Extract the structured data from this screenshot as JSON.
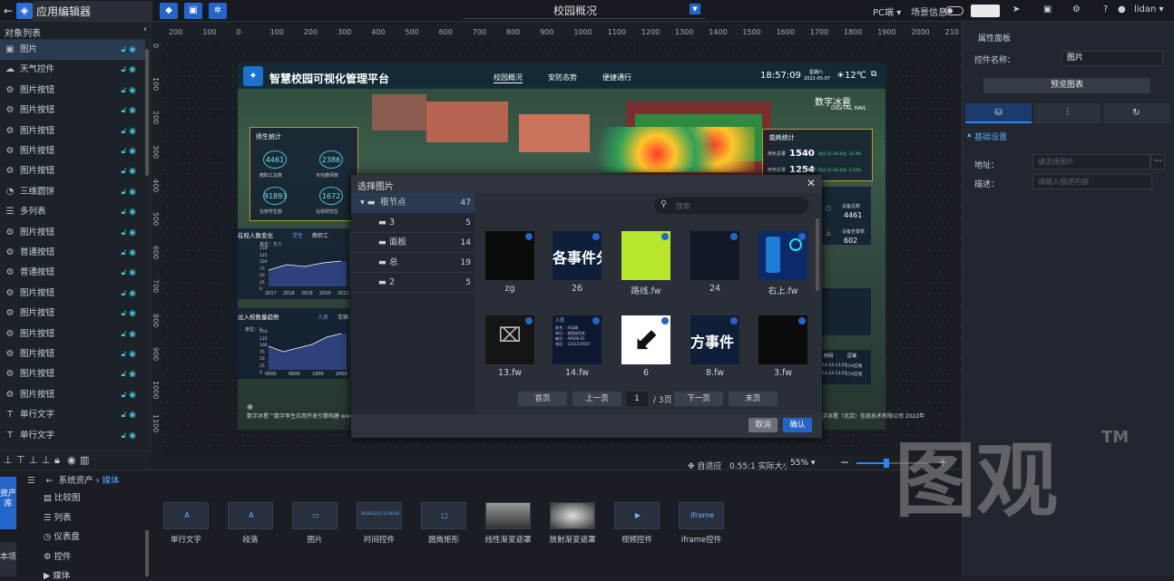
{
  "app": {
    "back_icon": "arrow-left-icon",
    "title": "应用编辑器",
    "page_name": "校园概况",
    "device": "PC端",
    "scene_info": "场景信息",
    "user": "lidan"
  },
  "left_panel": {
    "title": "对象列表",
    "layers": [
      {
        "label": "图片",
        "icon": "image-icon",
        "selected": true
      },
      {
        "label": "天气控件",
        "icon": "weather-icon"
      },
      {
        "label": "图片按钮",
        "icon": "gear-icon"
      },
      {
        "label": "图片按钮",
        "icon": "gear-icon"
      },
      {
        "label": "图片按钮",
        "icon": "gear-icon"
      },
      {
        "label": "图片按钮",
        "icon": "gear-icon"
      },
      {
        "label": "图片按钮",
        "icon": "gear-icon"
      },
      {
        "label": "三维圆饼",
        "icon": "pie-icon"
      },
      {
        "label": "多列表",
        "icon": "list-icon"
      },
      {
        "label": "图片按钮",
        "icon": "gear-icon"
      },
      {
        "label": "普通按钮",
        "icon": "gear-icon"
      },
      {
        "label": "普通按钮",
        "icon": "gear-icon"
      },
      {
        "label": "图片按钮",
        "icon": "gear-icon"
      },
      {
        "label": "图片按钮",
        "icon": "gear-icon"
      },
      {
        "label": "图片按钮",
        "icon": "gear-icon"
      },
      {
        "label": "图片按钮",
        "icon": "gear-icon"
      },
      {
        "label": "图片按钮",
        "icon": "gear-icon"
      },
      {
        "label": "图片按钮",
        "icon": "gear-icon"
      },
      {
        "label": "单行文字",
        "icon": "text-icon"
      },
      {
        "label": "单行文字",
        "icon": "text-icon"
      }
    ]
  },
  "rulers": {
    "h": [
      "200",
      "100",
      "0",
      "100",
      "200",
      "300",
      "400",
      "500",
      "600",
      "700",
      "800",
      "900",
      "1000",
      "1100",
      "1200",
      "1300",
      "1400",
      "1500",
      "1600",
      "1700",
      "1800",
      "1900",
      "2000",
      "210"
    ],
    "v": [
      "0",
      "100",
      "200",
      "300",
      "400",
      "500",
      "600",
      "700",
      "800",
      "900",
      "1000",
      "1100"
    ]
  },
  "dashboard": {
    "title": "智慧校园可视化管理平台",
    "tabs": [
      "校园概况",
      "安防态势",
      "便捷通行"
    ],
    "time": "18:57:09",
    "weekday": "星期六",
    "date": "2022-05-07",
    "temp": "12℃",
    "brand": "数字冰雹",
    "brand_en": "DIGITAL HAIL",
    "left_panel_title": "师生统计",
    "stats": [
      {
        "value": "4461",
        "label": "教职工总数"
      },
      {
        "value": "2386",
        "label": "专任教师数"
      },
      {
        "value": "91893",
        "label": "在校学生数"
      },
      {
        "value": "1672",
        "label": "在校研究生"
      }
    ],
    "enroll_title": "在校人数变化",
    "enroll_tabs": [
      "学生",
      "教职工"
    ],
    "enroll_unit": "单位：万人",
    "enroll_years": [
      "2017",
      "2018",
      "2019",
      "2020",
      "2021"
    ],
    "enroll_y": [
      "150",
      "125",
      "100",
      "75",
      "50",
      "25",
      "0"
    ],
    "flow_title": "出入校数量趋势",
    "flow_tabs": [
      "人员",
      "车辆"
    ],
    "flow_unit": "单位：人",
    "flow_x": [
      "0000",
      "0600",
      "1800",
      "2400"
    ],
    "flow_y": [
      "150",
      "125",
      "100",
      "75",
      "50",
      "25",
      "0"
    ],
    "right_title": "能耗统计",
    "right_rows": [
      {
        "label": "用水总量",
        "value": "1540",
        "unit": "t",
        "extra": "同比 12.3%  环比 -11.3%"
      },
      {
        "label": "用电总量",
        "value": "1254",
        "unit": "kWh",
        "extra": "同比 12.3%  环比 -1.12%"
      }
    ],
    "device_total": "4461",
    "device_total_label": "设备总数",
    "device_alarm": "602",
    "device_alarm_label": "设备告警数",
    "table_header": [
      "时间",
      "区域"
    ],
    "table_rows": [
      [
        "12-14 13:25",
        "C1A区域"
      ],
      [
        "12-14 13:25",
        "C1A区域"
      ]
    ],
    "footer_left": "数字冰雹™数字孪生应用开发引擎构建 www.digihail.com",
    "footer_right": "数字冰雹（北京）信息技术有限公司 2022年"
  },
  "modal": {
    "title": "选择图片",
    "search_placeholder": "搜索",
    "tree": [
      {
        "label": "根节点",
        "count": "47",
        "root": true
      },
      {
        "label": "3",
        "count": "5"
      },
      {
        "label": "面板",
        "count": "14"
      },
      {
        "label": "总",
        "count": "19"
      },
      {
        "label": "2",
        "count": "5"
      }
    ],
    "images": [
      {
        "label": "zg",
        "kind": "black"
      },
      {
        "label": "26",
        "kind": "text",
        "text": "各事件分"
      },
      {
        "label": "路线.fw",
        "kind": "lime"
      },
      {
        "label": "24",
        "kind": "navy"
      },
      {
        "label": "右上.fw",
        "kind": "phone"
      },
      {
        "label": "13.fw",
        "kind": "face"
      },
      {
        "label": "14.fw",
        "kind": "card",
        "card_title": "人员",
        "card_rows": [
          "姓名：  刘培雄",
          "单位：  校园安防处",
          "编号：  A0000-01",
          "电话：  1341234567"
        ]
      },
      {
        "label": "6",
        "kind": "arrow"
      },
      {
        "label": "8.fw",
        "kind": "text2",
        "text": "方事件"
      },
      {
        "label": "3.fw",
        "kind": "black"
      }
    ],
    "pager": {
      "first": "首页",
      "prev": "上一页",
      "current": "1",
      "total": "/ 3页",
      "next": "下一页",
      "last": "末页"
    },
    "cancel": "取消",
    "confirm": "确认"
  },
  "zoom": {
    "fit": "自适应",
    "ratio": "0.55:1 实际大小",
    "value": "55%"
  },
  "bottom": {
    "asset_tab": "资产库",
    "asset_tab2": "本项",
    "breadcrumb_root": "系统资产",
    "breadcrumb_sep": "›",
    "breadcrumb_current": "媒体",
    "categories": [
      {
        "label": "比较图",
        "icon": "compare-icon"
      },
      {
        "label": "列表",
        "icon": "list-icon"
      },
      {
        "label": "仪表盘",
        "icon": "gauge-icon"
      },
      {
        "label": "控件",
        "icon": "gear-icon"
      },
      {
        "label": "媒体",
        "icon": "media-icon"
      }
    ],
    "components": [
      {
        "label": "单行文字",
        "preview": "A"
      },
      {
        "label": "段落",
        "preview": "A"
      },
      {
        "label": "图片",
        "preview": "▭"
      },
      {
        "label": "时间控件",
        "preview": "2019/12/12 12:00:00"
      },
      {
        "label": "圆角矩形",
        "preview": "▢"
      },
      {
        "label": "线性渐变遮罩",
        "preview": ""
      },
      {
        "label": "放射渐变遮罩",
        "preview": ""
      },
      {
        "label": "视频控件",
        "preview": "▶"
      },
      {
        "label": "iframe控件",
        "preview": "iframe"
      }
    ]
  },
  "right_panel": {
    "title": "属性面板",
    "name_label": "控件名称：",
    "name_value": "图片",
    "preview_button": "预览图表",
    "section": "基础设置",
    "address_label": "地址：",
    "address_placeholder": "请选择图片",
    "desc_label": "描述：",
    "desc_placeholder": "请输入描述内容"
  },
  "watermark": "图观",
  "watermark_tm": "TM"
}
